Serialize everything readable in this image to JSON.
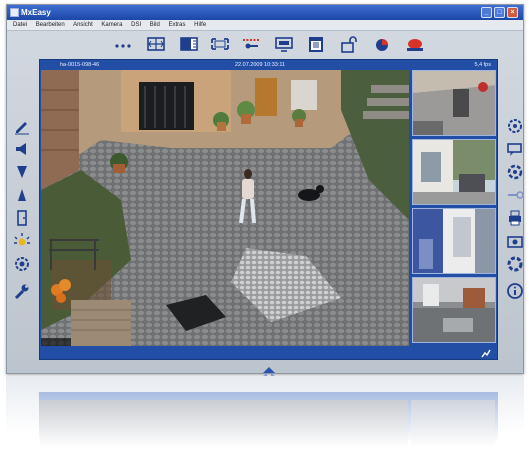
{
  "window": {
    "title": "MxEasy",
    "controls": [
      "minimize",
      "maximize",
      "close"
    ]
  },
  "menu": [
    "Datei",
    "Bearbeiten",
    "Ansicht",
    "Kamera",
    "DSI",
    "Bild",
    "Extras",
    "Hilfe"
  ],
  "toolbar": {
    "icons": [
      "more-dots-icon",
      "layout-switch-icon",
      "split-view-icon",
      "fullscreen-icon",
      "record-icon",
      "monitor-icon",
      "calendar-icon",
      "lock-icon",
      "pie-icon",
      "alarm-icon"
    ]
  },
  "left_sidebar": {
    "icons": [
      "pen-icon",
      "speaker-icon",
      "down-arrow-icon",
      "up-arrow-icon",
      "door-icon",
      "light-icon",
      "settings-gear-icon",
      "wrench-icon"
    ]
  },
  "right_sidebar": {
    "icons": [
      "gear-icon",
      "comment-icon",
      "target-icon",
      "arrow-right-icon",
      "print-icon",
      "camera-icon",
      "lifebuoy-icon",
      "info-icon"
    ]
  },
  "main_view": {
    "camera_name": "ha-0015-098-46",
    "timestamp": "22.07.2009 10:33:11",
    "fps": "5,4 fps"
  },
  "thumbnails": [
    "thumbnail-1",
    "thumbnail-2",
    "thumbnail-3",
    "thumbnail-4"
  ],
  "colors": {
    "accent": "#234ea5",
    "icon": "#1f3f8e",
    "titlebar": "#2a57bf"
  }
}
